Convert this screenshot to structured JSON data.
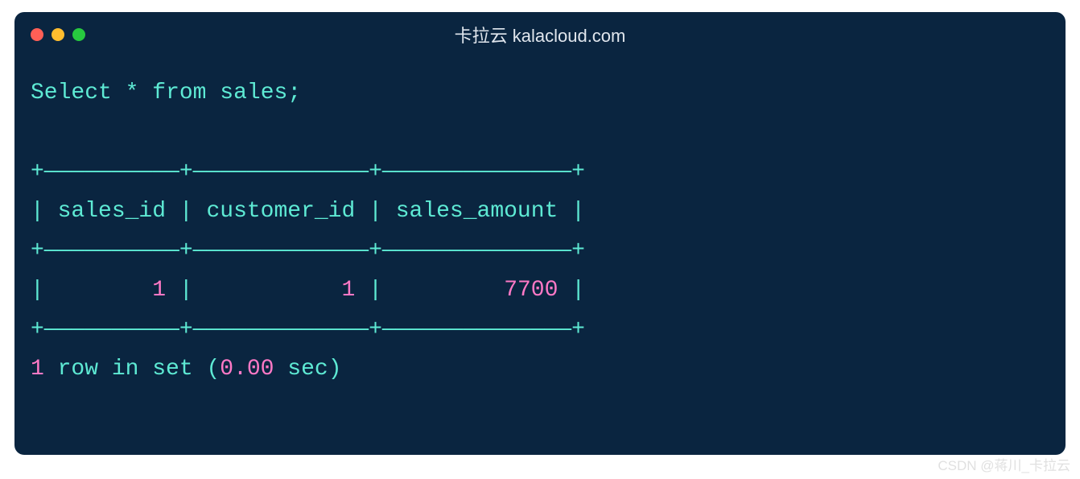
{
  "window": {
    "title": "卡拉云 kalacloud.com"
  },
  "query": {
    "select": "Select",
    "star": "*",
    "from": "from",
    "table": "sales",
    "semicolon": ";"
  },
  "table": {
    "border_top": "+——————————+—————————————+——————————————+",
    "header_pipe1": "|",
    "header_col1": " sales_id ",
    "header_pipe2": "|",
    "header_col2": " customer_id ",
    "header_pipe3": "|",
    "header_col3": " sales_amount ",
    "header_pipe4": "|",
    "border_mid": "+——————————+—————————————+——————————————+",
    "row_pipe1": "|",
    "row_val1_pad": "        ",
    "row_val1": "1",
    "row_val1_end": " ",
    "row_pipe2": "|",
    "row_val2_pad": "           ",
    "row_val2": "1",
    "row_val2_end": " ",
    "row_pipe3": "|",
    "row_val3_pad": "         ",
    "row_val3": "7700",
    "row_val3_end": " ",
    "row_pipe4": "|",
    "border_bot": "+——————————+—————————————+——————————————+"
  },
  "footer": {
    "count": "1",
    "rows_text": " row in set ",
    "paren_open": "(",
    "time": "0.00",
    "sec_text": " sec",
    "paren_close": ")"
  },
  "watermark": "CSDN @蒋川_卡拉云"
}
